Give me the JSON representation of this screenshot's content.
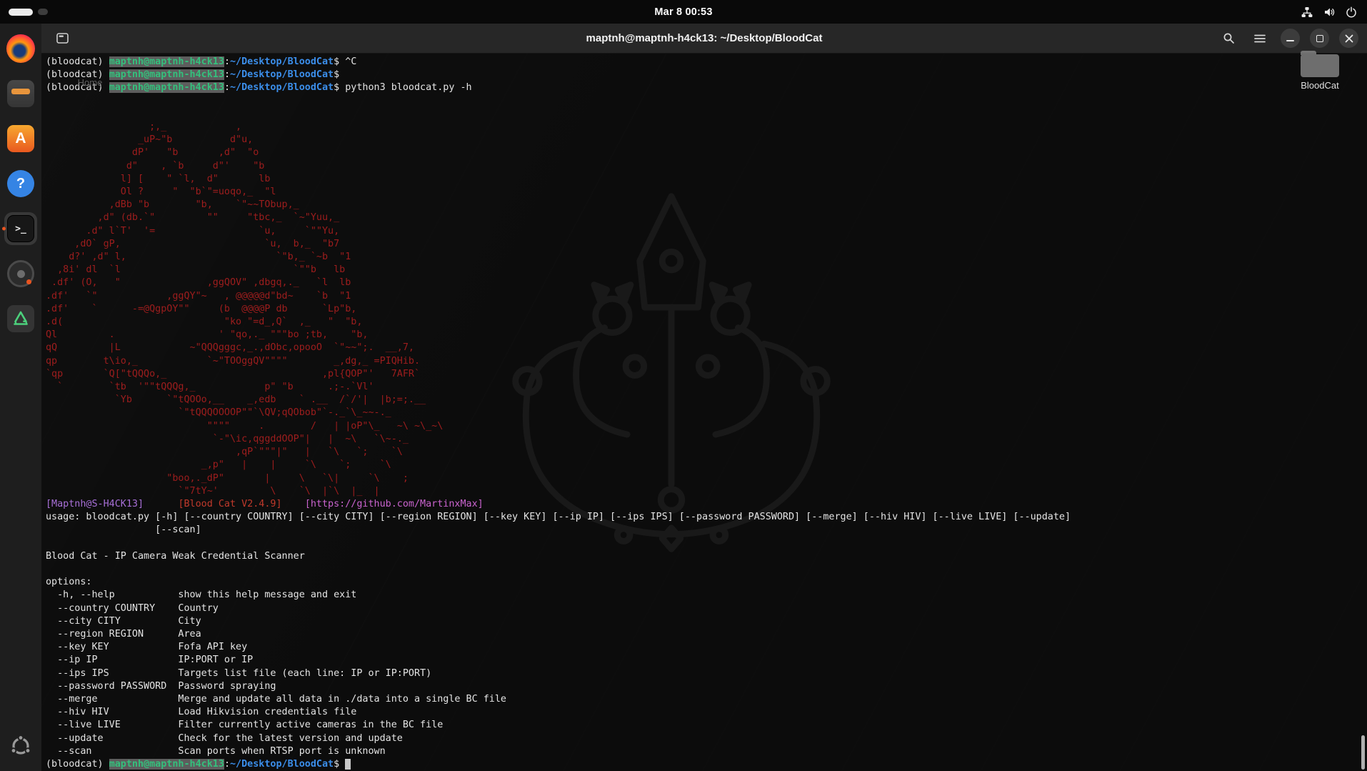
{
  "top_bar": {
    "clock": "Mar 8  00:53",
    "workspace_indicator": "active-pill",
    "status_icons": [
      "network-icon",
      "volume-icon",
      "power-icon"
    ]
  },
  "dock": {
    "items": [
      {
        "name": "firefox"
      },
      {
        "name": "files"
      },
      {
        "name": "app-center"
      },
      {
        "name": "help"
      },
      {
        "name": "terminal",
        "active": true
      },
      {
        "name": "disks"
      },
      {
        "name": "trash"
      },
      {
        "name": "show-apps"
      }
    ],
    "app_center_glyph": "A",
    "help_glyph": "?",
    "terminal_glyph": ">_"
  },
  "desktop": {
    "icons": [
      {
        "label": "Home"
      },
      {
        "label": "BloodCat"
      }
    ]
  },
  "window": {
    "title": "maptnh@maptnh-h4ck13: ~/Desktop/BloodCat",
    "header_buttons": [
      "new-tab",
      "search",
      "menu",
      "minimize",
      "maximize",
      "close"
    ]
  },
  "terminal": {
    "prompt": {
      "venv": "(bloodcat)",
      "user": "maptnh@maptnh-h4ck13",
      "path": "~/Desktop/BloodCat"
    },
    "lines": [
      [
        [
          "d",
          "(bloodcat) "
        ],
        [
          "u",
          "maptnh@maptnh-h4ck13"
        ],
        [
          "d",
          ":"
        ],
        [
          "p",
          "~/Desktop/BloodCat"
        ],
        [
          "d",
          "$ ^C"
        ]
      ],
      [
        [
          "d",
          "(bloodcat) "
        ],
        [
          "u",
          "maptnh@maptnh-h4ck13"
        ],
        [
          "d",
          ":"
        ],
        [
          "p",
          "~/Desktop/BloodCat"
        ],
        [
          "d",
          "$"
        ]
      ],
      [
        [
          "d",
          "(bloodcat) "
        ],
        [
          "u",
          "maptnh@maptnh-h4ck13"
        ],
        [
          "d",
          ":"
        ],
        [
          "p",
          "~/Desktop/BloodCat"
        ],
        [
          "d",
          "$ python3 bloodcat.py -h"
        ]
      ],
      [],
      [],
      [
        [
          "a",
          "                  ;,_            ,"
        ]
      ],
      [
        [
          "a",
          "                _uP~\"b          d\"u,"
        ]
      ],
      [
        [
          "a",
          "               dP'   \"b       ,d\"  \"o"
        ]
      ],
      [
        [
          "a",
          "              d\"    , `b     d\"'    \"b"
        ]
      ],
      [
        [
          "a",
          "             l] [    \" `l,  d\"       lb"
        ]
      ],
      [
        [
          "a",
          "             Ol ?     \"  \"b`\"=uoqo,_  \"l"
        ]
      ],
      [
        [
          "a",
          "           ,dBb \"b        \"b,    `\"~~TObup,_"
        ]
      ],
      [
        [
          "a",
          "         ,d\" (db.`\"         \"\"     \"tbc,_  `~\"Yuu,_"
        ]
      ],
      [
        [
          "a",
          "       .d\" l`T'  '=                  `u,     `\"\"Yu,"
        ]
      ],
      [
        [
          "a",
          "     ,dO` gP,                         `u,  b,_  \"b7"
        ]
      ],
      [
        [
          "a",
          "    d?' ,d\" l,                          `\"b,_ `~b  \"1"
        ]
      ],
      [
        [
          "a",
          "  ,8i' dl  `l                              `\"\"b   lb"
        ]
      ],
      [
        [
          "a",
          " .df' (O,   \"               ,ggQOV\" ,dbgq,._   `l  lb"
        ]
      ],
      [
        [
          "a",
          ".df'   `\"            ,ggQY\"~   , @@@@@d\"bd~    `b  \"1"
        ]
      ],
      [
        [
          "a",
          ".df'    `      -=@QgpOY\"\"     (b  @@@@P db      `Lp\"b,"
        ]
      ],
      [
        [
          "a",
          ".d(                            \"ko \"=d_,Q`  ,_   \"  \"b,"
        ]
      ],
      [
        [
          "a",
          "Ql         .                  ' \"qo,._ \"\"\"bo ;tb,    \"b,"
        ]
      ],
      [
        [
          "a",
          "qQ         |L            ~\"QQQgggc,_.,dObc,opooO  `\"~~\";.  __,7,"
        ]
      ],
      [
        [
          "a",
          "qp        t\\io,_            `~\"TOOggQV\"\"\"\"        _,dg,_ =PIQHib."
        ]
      ],
      [
        [
          "a",
          "`qp       `Q[\"tQQQo,_                           ,pl{QOP\"'   7AFR`"
        ]
      ],
      [
        [
          "a",
          "  `        `tb  '\"\"tQQQg,_            p\" \"b      .;-.`Vl'"
        ]
      ],
      [
        [
          "a",
          "            `Yb      `\"tQOOo,__    _,edb    ` .__  /`/'|  |b;=;.__"
        ]
      ],
      [
        [
          "a",
          "                       `\"tQQQOOOOP\"\"`\\QV;qQObob\"`-._`\\_~~-._"
        ]
      ],
      [
        [
          "a",
          "                            \"\"\"\"     .        /   | |oP\"\\_   ~\\ ~\\_~\\"
        ]
      ],
      [
        [
          "a",
          "                             `-\"\\ic,qggddOOP\"|   |  ~\\   `\\~-._"
        ]
      ],
      [
        [
          "a",
          "                                 ,qP`\"\"\"|\"   |   `\\   `;    `\\"
        ]
      ],
      [
        [
          "a",
          "                           _,p\"   |    |     `\\    `;     `\\"
        ]
      ],
      [
        [
          "a",
          "                     \"boo,._dP\"       |     \\   `\\|     `\\    ;"
        ]
      ],
      [
        [
          "a",
          "                       `\"7tY~'         \\    `\\  |`\\  |_  |"
        ]
      ],
      [
        [
          "t1",
          "[Maptnh@S-H4CK13]"
        ],
        [
          "d",
          "      "
        ],
        [
          "t2",
          "[Blood Cat V2.4.9]"
        ],
        [
          "d",
          "    "
        ],
        [
          "t3",
          "[https://github.com/MartinxMax]"
        ]
      ],
      [
        [
          "d",
          "usage: bloodcat.py [-h] [--country COUNTRY] [--city CITY] [--region REGION] [--key KEY] [--ip IP] [--ips IPS] [--password PASSWORD] [--merge] [--hiv HIV] [--live LIVE] [--update]"
        ]
      ],
      [
        [
          "d",
          "                   [--scan]"
        ]
      ],
      [],
      [
        [
          "d",
          "Blood Cat - IP Camera Weak Credential Scanner"
        ]
      ],
      [],
      [
        [
          "d",
          "options:"
        ]
      ],
      [
        [
          "d",
          "  -h, --help           show this help message and exit"
        ]
      ],
      [
        [
          "d",
          "  --country COUNTRY    Country"
        ]
      ],
      [
        [
          "d",
          "  --city CITY          City"
        ]
      ],
      [
        [
          "d",
          "  --region REGION      Area"
        ]
      ],
      [
        [
          "d",
          "  --key KEY            Fofa API key"
        ]
      ],
      [
        [
          "d",
          "  --ip IP              IP:PORT or IP"
        ]
      ],
      [
        [
          "d",
          "  --ips IPS            Targets list file (each line: IP or IP:PORT)"
        ]
      ],
      [
        [
          "d",
          "  --password PASSWORD  Password spraying"
        ]
      ],
      [
        [
          "d",
          "  --merge              Merge and update all data in ./data into a single BC file"
        ]
      ],
      [
        [
          "d",
          "  --hiv HIV            Load Hikvision credentials file"
        ]
      ],
      [
        [
          "d",
          "  --live LIVE          Filter currently active cameras in the BC file"
        ]
      ],
      [
        [
          "d",
          "  --update             Check for the latest version and update"
        ]
      ],
      [
        [
          "d",
          "  --scan               Scan ports when RTSP port is unknown"
        ]
      ],
      [
        [
          "d",
          "(bloodcat) "
        ],
        [
          "u",
          "maptnh@maptnh-h4ck13"
        ],
        [
          "d",
          ":"
        ],
        [
          "p",
          "~/Desktop/BloodCat"
        ],
        [
          "d",
          "$ "
        ],
        [
          "c",
          " "
        ]
      ]
    ]
  },
  "colors": {
    "foreground": "#e4e4e4",
    "ascii_art_red": "#9d1d1d",
    "prompt_user_green": "#34c07c",
    "prompt_path_blue": "#3b8eea",
    "tag_purple": "#a76fd6",
    "tag_red": "#c0392b",
    "tag_magenta": "#c963ce",
    "accent_orange": "#e95420",
    "highlight_gray": "#5d5d5d",
    "cursor_gray": "#c9c9c9",
    "terminal_bg": "rgba(8,8,8,0.74)"
  }
}
